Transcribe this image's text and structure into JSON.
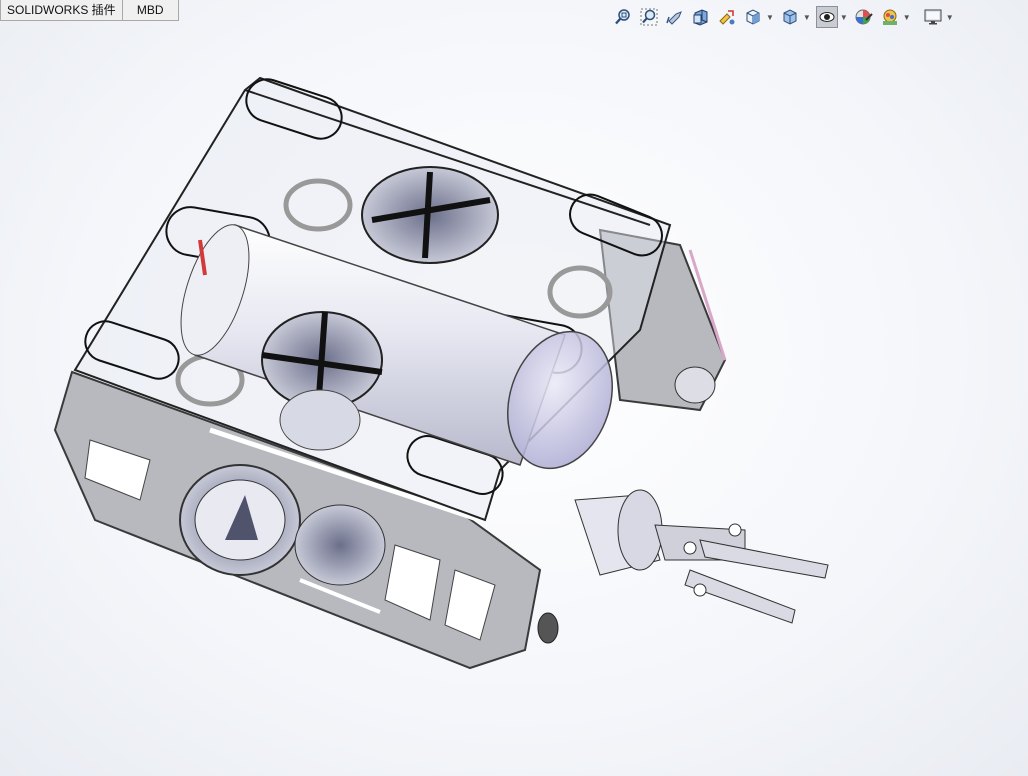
{
  "tabs": [
    {
      "label": "SOLIDWORKS 插件"
    },
    {
      "label": "MBD"
    }
  ],
  "heads_up_toolbar": {
    "buttons": [
      {
        "name": "zoom-to-fit-icon"
      },
      {
        "name": "zoom-to-area-icon"
      },
      {
        "name": "previous-view-icon"
      },
      {
        "name": "section-view-icon"
      },
      {
        "name": "dynamic-annotation-views-icon"
      },
      {
        "name": "view-orientation-icon",
        "dropdown": true
      },
      {
        "name": "display-style-icon",
        "dropdown": true
      },
      {
        "name": "hide-show-items-icon",
        "dropdown": true,
        "active": true
      },
      {
        "name": "edit-appearance-icon"
      },
      {
        "name": "apply-scene-icon",
        "dropdown": true
      },
      {
        "name": "view-settings-icon",
        "dropdown": true
      }
    ]
  },
  "viewport": {
    "model": "underwater ROV assembly with thrusters, electronics cylinder and gripper arm",
    "colors": {
      "frame_fill": "#b7b9bf",
      "frame_stroke": "#3a3a3a",
      "transparent_lid": "#e6e8f2",
      "cylinder": "#dcdde8",
      "dome": "#c9c8e6",
      "accent_pink": "#d9a7c7",
      "accent_red": "#d23a3a"
    }
  }
}
